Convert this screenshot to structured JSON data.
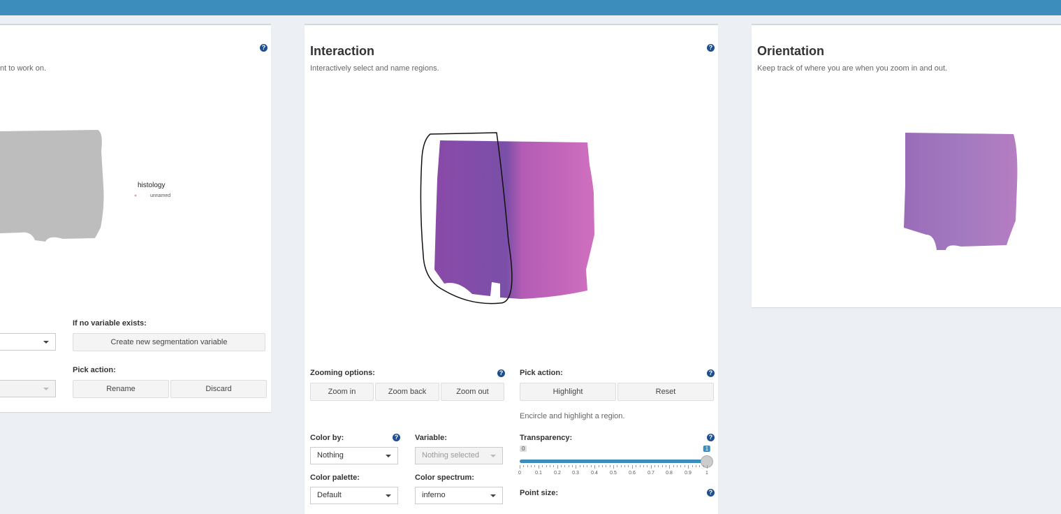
{
  "left_panel": {
    "subtitle_fragment": "nt to work on.",
    "legend_title": "histology",
    "legend_item": "unnamed",
    "if_no_variable_label": "If no variable exists:",
    "create_button": "Create new segmentation variable",
    "pick_action_label": "Pick action:",
    "rename_button": "Rename",
    "discard_button": "Discard"
  },
  "interaction_panel": {
    "title": "Interaction",
    "subtitle": "Interactively select and name regions.",
    "zooming_label": "Zooming options:",
    "zoom_in": "Zoom in",
    "zoom_back": "Zoom back",
    "zoom_out": "Zoom out",
    "pick_action_label": "Pick action:",
    "highlight": "Highlight",
    "reset": "Reset",
    "hint": "Encircle and highlight a region.",
    "color_by_label": "Color by:",
    "color_by_value": "Nothing",
    "variable_label": "Variable:",
    "variable_value": "Nothing selected",
    "transparency_label": "Transparency:",
    "transparency_min": "0",
    "transparency_value": "1",
    "transparency_fraction": 1,
    "transparency_ticks": [
      "0",
      "0.1",
      "0.2",
      "0.3",
      "0.4",
      "0.5",
      "0.6",
      "0.7",
      "0.8",
      "0.9",
      "1"
    ],
    "color_palette_label": "Color palette:",
    "color_palette_value": "Default",
    "color_spectrum_label": "Color spectrum:",
    "color_spectrum_value": "inferno",
    "point_size_label": "Point size:"
  },
  "orientation_panel": {
    "title": "Orientation",
    "subtitle": "Keep track of where you are when you zoom in and out."
  },
  "help_icon_glyph": "?",
  "colors": {
    "topbar": "#3c8dbc",
    "slider_fill": "#3c8dbc",
    "help_icon": "#1f4e8c",
    "tissue_purple": "#9b4fb0",
    "tissue_gray": "#bdbdbd"
  }
}
